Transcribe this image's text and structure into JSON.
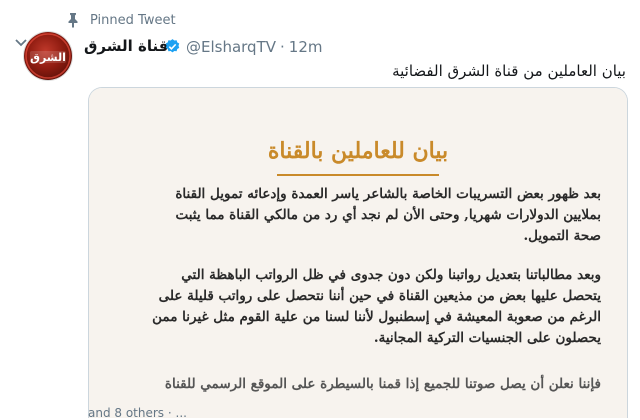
{
  "pinned": {
    "label": "Pinned Tweet",
    "icon": "pin-icon"
  },
  "author": {
    "display_name": "قناة الشرق",
    "handle": "@ElsharqTV",
    "separator": "·",
    "time": "12m",
    "verified": true,
    "avatar_text": "الشرق"
  },
  "tweet": {
    "text": "بيان العاملين من قناة الشرق الفضائية"
  },
  "document": {
    "title": "بيان للعاملين بالقناة",
    "paragraph1": [
      "بعد ظهور بعض التسريبات الخاصة بالشاعر ياسر العمدة وإدعائه تمويل القناة",
      "بملايين الدولارات شهريا, وحتى الأن لم نجد أي رد من مالكي القناة مما يثبت",
      "صحة التمويل."
    ],
    "paragraph2": [
      "وبعد مطالباتنا بتعديل رواتبنا ولكن دون جدوى في ظل الرواتب الباهظة التي",
      "يتحصل عليها بعض من مذيعين القناة في حين أننا نتحصل على رواتب قليلة على",
      "الرغم من صعوبة المعيشة في إسطنبول لأننا لسنا من علية القوم مثل غيرنا ممن",
      "يحصلون على الجنسيات التركية المجانية."
    ],
    "paragraph3": [
      "فإننا نعلن أن يصل صوتنا للجميع إذا قمنا بالسيطرة على الموقع الرسمي للقناة"
    ]
  },
  "footer": {
    "text": "and 8 others · ..."
  },
  "colors": {
    "accent_blue": "#1da1f2",
    "muted": "#657786",
    "doc_title": "#c98a2a"
  }
}
